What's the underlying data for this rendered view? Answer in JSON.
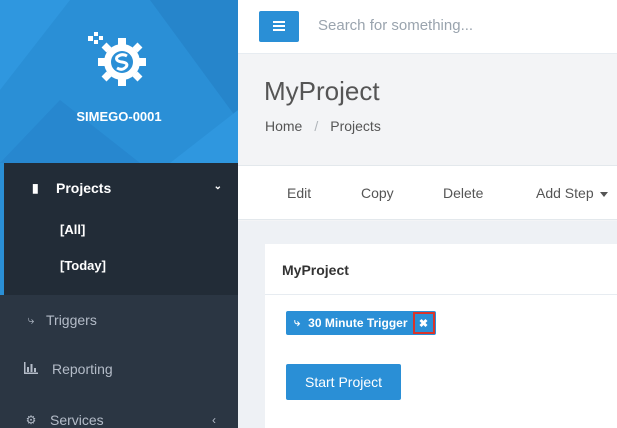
{
  "brand": {
    "name": "SIMEGO-0001",
    "logo_icon": "gear-logo-icon"
  },
  "sidebar": {
    "projects": {
      "label": "Projects",
      "icon": "book-icon",
      "expanded": true,
      "sub_items": [
        "[All]",
        "[Today]"
      ]
    },
    "items": [
      {
        "label": "Triggers",
        "icon": "bolt-icon"
      },
      {
        "label": "Reporting",
        "icon": "bar-chart-icon"
      },
      {
        "label": "Services",
        "icon": "cogs-icon"
      }
    ]
  },
  "header": {
    "search_placeholder": "Search for something...",
    "menu_icon": "hamburger-icon"
  },
  "page": {
    "title": "MyProject",
    "breadcrumb": [
      "Home",
      "Projects"
    ],
    "breadcrumb_separator": "/"
  },
  "toolbar": {
    "edit": "Edit",
    "copy": "Copy",
    "delete": "Delete",
    "add_step": "Add Step"
  },
  "portlet": {
    "title": "MyProject",
    "trigger_tag": {
      "label": "30 Minute Trigger",
      "icon": "bolt-icon",
      "remove_icon": "times-icon"
    },
    "start_button": "Start Project"
  },
  "colors": {
    "accent": "#2a8fd6",
    "sidebar": "#2b3643",
    "sidebar_active": "#222c37",
    "highlight_border": "#d9342b"
  }
}
